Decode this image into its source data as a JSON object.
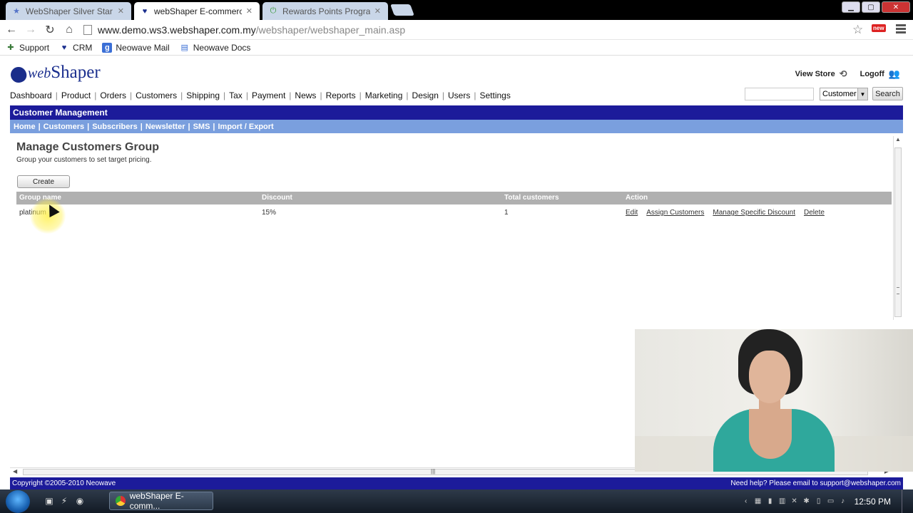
{
  "browser": {
    "tabs": [
      {
        "label": "WebShaper Silver Star Tem",
        "icon": "star-icon",
        "active": false
      },
      {
        "label": "webShaper E-commerce",
        "icon": "webshaper-icon",
        "active": true
      },
      {
        "label": "Rewards Points Program",
        "icon": "power-icon",
        "active": false
      }
    ],
    "url_host": "www.demo.ws3.webshaper.com.my",
    "url_path": "/webshaper/webshaper_main.asp",
    "bookmarks": [
      {
        "label": "Support",
        "icon": "support-icon"
      },
      {
        "label": "CRM",
        "icon": "crm-icon"
      },
      {
        "label": "Neowave Mail",
        "icon": "google-mail-icon"
      },
      {
        "label": "Neowave Docs",
        "icon": "docs-icon"
      }
    ],
    "ext_badge": "new"
  },
  "app": {
    "logo": {
      "prefix": "web",
      "name": "Shaper"
    },
    "view_store": "View Store",
    "logoff": "Logoff",
    "nav": [
      "Dashboard",
      "Product",
      "Orders",
      "Customers",
      "Shipping",
      "Tax",
      "Payment",
      "News",
      "Reports",
      "Marketing",
      "Design",
      "Users",
      "Settings"
    ],
    "search": {
      "value": "",
      "scope": "Customer",
      "button": "Search"
    },
    "section_title": "Customer Management",
    "subnav": [
      "Home",
      "Customers",
      "Subscribers",
      "Newsletter",
      "SMS",
      "Import / Export"
    ]
  },
  "main": {
    "title": "Manage Customers Group",
    "description": "Group your customers to set target pricing.",
    "create_label": "Create",
    "columns": [
      "Group name",
      "Discount",
      "Total customers",
      "Action"
    ],
    "rows": [
      {
        "group": "platinum",
        "discount": "15%",
        "total": "1",
        "actions": [
          "Edit",
          "Assign Customers",
          "Manage Specific Discount",
          "Delete"
        ]
      }
    ]
  },
  "footer": {
    "copyright": "Copyright ©2005-2010 Neowave",
    "help": "Need help? Please email to support@webshaper.com"
  },
  "taskbar": {
    "active_window": "webShaper E-comm...",
    "clock": "12:50 PM"
  },
  "colors": {
    "brand_blue": "#1c1b9a",
    "subnav_blue": "#7a9fde",
    "grid_header": "#b0b0b0"
  }
}
